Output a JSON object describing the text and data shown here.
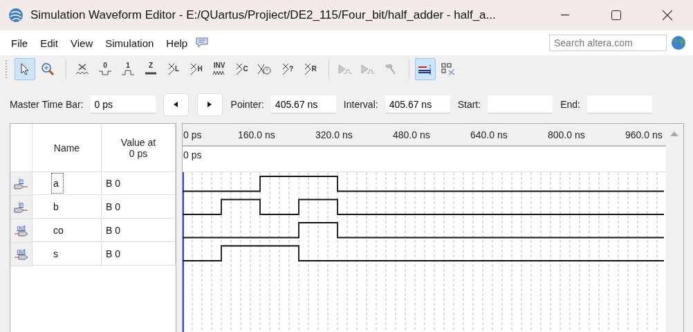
{
  "window": {
    "title": "Simulation Waveform Editor - E:/QUartus/Projiect/DE2_115/Four_bit/half_adder - half_a..."
  },
  "menu": [
    "File",
    "Edit",
    "View",
    "Simulation",
    "Help"
  ],
  "search": {
    "placeholder": "Search altera.com"
  },
  "toolbar": [
    {
      "kind": "pointer",
      "selected": true
    },
    {
      "kind": "zoom",
      "selected": false
    },
    {
      "kind": "sep"
    },
    {
      "kind": "unknown",
      "selected": false
    },
    {
      "kind": "low",
      "glyph": "0",
      "selected": false
    },
    {
      "kind": "high",
      "glyph": "1",
      "selected": false
    },
    {
      "kind": "hiz",
      "glyph": "Z",
      "selected": false
    },
    {
      "kind": "bus",
      "glyph": "L",
      "selected": false
    },
    {
      "kind": "bus",
      "glyph": "H",
      "selected": false
    },
    {
      "kind": "inv",
      "glyph": "INV",
      "selected": false
    },
    {
      "kind": "bus",
      "glyph": "C",
      "selected": false
    },
    {
      "kind": "clock",
      "selected": false
    },
    {
      "kind": "bus",
      "glyph": "?",
      "selected": false
    },
    {
      "kind": "bus",
      "glyph": "R",
      "selected": false
    },
    {
      "kind": "sep"
    },
    {
      "kind": "run",
      "selected": false,
      "disabled": true
    },
    {
      "kind": "run2",
      "selected": false,
      "disabled": true
    },
    {
      "kind": "hammer",
      "selected": false,
      "disabled": true
    },
    {
      "kind": "sep"
    },
    {
      "kind": "snap",
      "selected": true
    },
    {
      "kind": "grid",
      "selected": false
    }
  ],
  "time_bar": [
    {
      "kind": "field",
      "label": "Master Time Bar:",
      "value": "0 ps"
    },
    {
      "kind": "prev"
    },
    {
      "kind": "next"
    },
    {
      "kind": "field",
      "label": "Pointer:",
      "value": "405.67 ns"
    },
    {
      "kind": "field",
      "label": "Interval:",
      "value": "405.67 ns"
    },
    {
      "kind": "field",
      "label": "Start:"
    },
    {
      "kind": "field",
      "label": "End:"
    }
  ],
  "table": {
    "columns": [
      "Name",
      "Value at\n0 ps"
    ],
    "rows": [
      {
        "kind": "input",
        "pin_label": "in",
        "name": "a",
        "value": "B 0",
        "selected": true,
        "wave": [
          false,
          false,
          true,
          true,
          false,
          false,
          false,
          false,
          false,
          false,
          false,
          false,
          false
        ]
      },
      {
        "kind": "input",
        "pin_label": "in",
        "name": "b",
        "value": "B 0",
        "selected": false,
        "wave": [
          false,
          true,
          false,
          true,
          false,
          false,
          false,
          false,
          false,
          false,
          false,
          false,
          false
        ]
      },
      {
        "kind": "output",
        "pin_label": "out",
        "name": "co",
        "value": "B 0",
        "selected": false,
        "wave": [
          false,
          false,
          false,
          true,
          false,
          false,
          false,
          false,
          false,
          false,
          false,
          false,
          false
        ]
      },
      {
        "kind": "output",
        "pin_label": "out",
        "name": "s",
        "value": "B 0",
        "selected": false,
        "wave": [
          false,
          true,
          true,
          false,
          false,
          false,
          false,
          false,
          false,
          false,
          false,
          false,
          false
        ]
      }
    ]
  },
  "ruler": {
    "start": "0 ps",
    "ticks": [
      "160.0 ns",
      "320.0 ns",
      "480.0 ns",
      "640.0 ns",
      "800.0 ns",
      "960.0 ns"
    ],
    "cursor": "0 ps"
  }
}
